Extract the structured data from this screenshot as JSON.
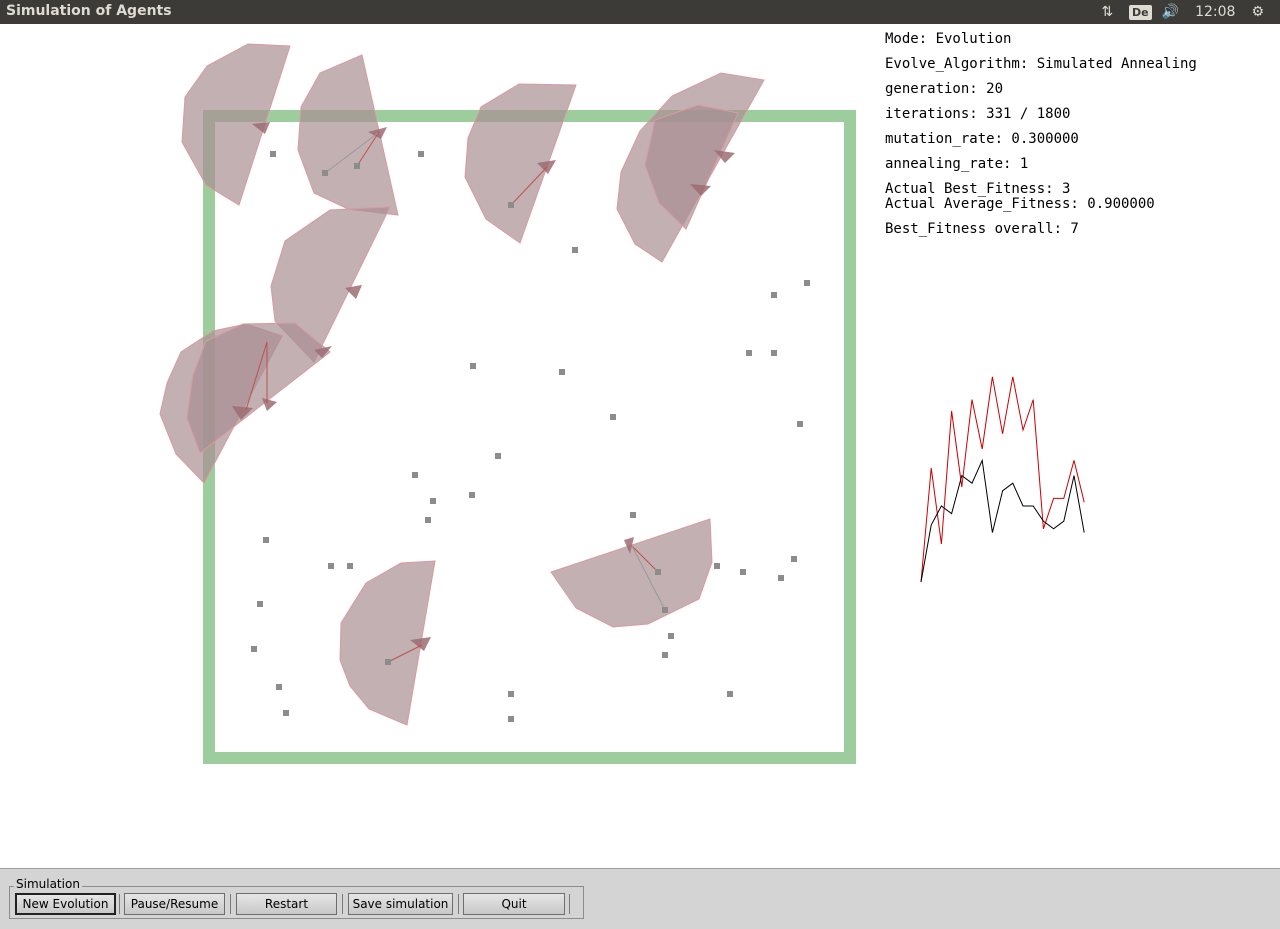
{
  "window": {
    "title": "Simulation of Agents"
  },
  "tray": {
    "keyboard": "De",
    "volume_icon": "speaker-icon",
    "network_icon": "transfer-arrows-icon",
    "time": "12:08",
    "settings_icon": "gear-icon"
  },
  "info": {
    "mode": "Mode: Evolution",
    "algorithm": "Evolve_Algorithm: Simulated Annealing",
    "generation": "generation: 20",
    "iterations": "iterations: 331 / 1800",
    "mutation_rate": "mutation_rate: 0.300000",
    "annealing_rate": "annealing_rate: 1",
    "best_fitness": "Actual Best_Fitness: 3",
    "avg_fitness": "Actual Average_Fitness: 0.900000",
    "best_overall": "Best_Fitness overall: 7"
  },
  "controls": {
    "group_label": "Simulation",
    "new_evolution": "New Evolution",
    "pause_resume": "Pause/Resume",
    "restart": "Restart",
    "save": "Save simulation",
    "quit": "Quit"
  },
  "colors": {
    "arena_border": "#8cc48c",
    "agent_fill": "#a88f93",
    "best_line": "#cc0000",
    "avg_line": "#000000"
  },
  "chart_data": {
    "type": "line",
    "series": [
      {
        "values": [
          0,
          3,
          1,
          4.5,
          2.5,
          4.8,
          3.5,
          5.4,
          3.9,
          5.4,
          4,
          4.8,
          1.4,
          2.2,
          2.2,
          3.2,
          2.1
        ]
      },
      {
        "values": [
          0,
          1.5,
          2,
          1.8,
          2.8,
          2.6,
          3.2,
          1.3,
          2.4,
          2.6,
          2,
          2,
          1.6,
          1.4,
          1.6,
          2.8,
          1.3
        ]
      }
    ]
  }
}
